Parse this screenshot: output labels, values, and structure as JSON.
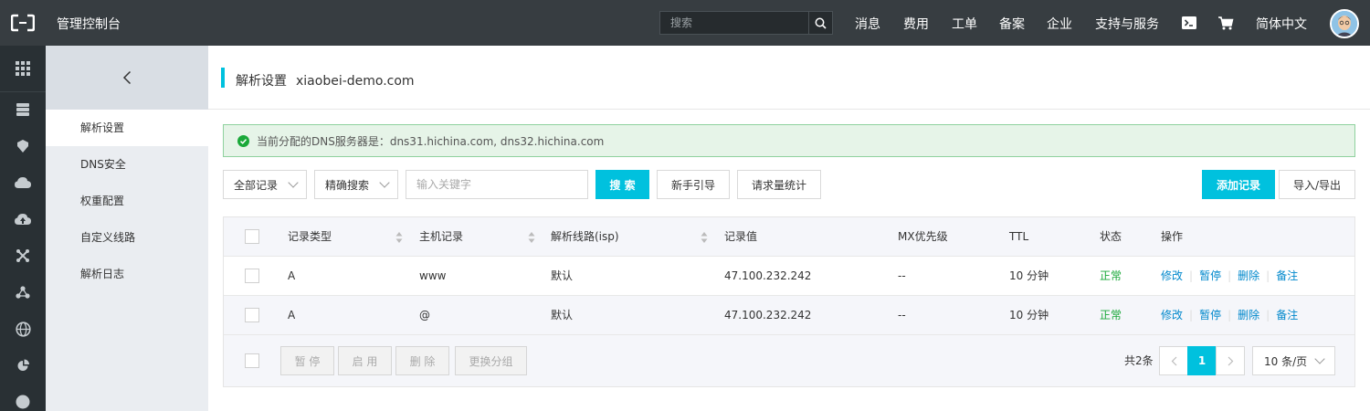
{
  "topbar": {
    "title": "管理控制台",
    "search_placeholder": "搜索",
    "nav": [
      "消息",
      "费用",
      "工单",
      "备案",
      "企业",
      "支持与服务"
    ],
    "language": "简体中文",
    "bg_color": "#373d41"
  },
  "subnav": {
    "items": [
      "解析设置",
      "DNS安全",
      "权重配置",
      "自定义线路",
      "解析日志"
    ],
    "active": "解析设置"
  },
  "page": {
    "title": "解析设置",
    "domain": "xiaobei-demo.com"
  },
  "alert": {
    "text": "当前分配的DNS服务器是：dns31.hichina.com, dns32.hichina.com"
  },
  "toolbar": {
    "record_filter": "全部记录",
    "search_mode": "精确搜索",
    "keyword_placeholder": "输入关键字",
    "search_label": "搜 索",
    "guide_label": "新手引导",
    "stats_label": "请求量统计",
    "add_label": "添加记录",
    "import_export_label": "导入/导出"
  },
  "table": {
    "columns": [
      "记录类型",
      "主机记录",
      "解析线路(isp)",
      "记录值",
      "MX优先级",
      "TTL",
      "状态",
      "操作"
    ],
    "rows": [
      {
        "type": "A",
        "host": "www",
        "line": "默认",
        "value": "47.100.232.242",
        "mx": "--",
        "ttl": "10 分钟",
        "status": "正常"
      },
      {
        "type": "A",
        "host": "@",
        "line": "默认",
        "value": "47.100.232.242",
        "mx": "--",
        "ttl": "10 分钟",
        "status": "正常"
      }
    ],
    "actions": [
      "修改",
      "暂停",
      "删除",
      "备注"
    ]
  },
  "footer": {
    "bulk_pause": "暂 停",
    "bulk_enable": "启 用",
    "bulk_delete": "删 除",
    "bulk_group": "更换分组",
    "total": "共2条",
    "current_page": "1",
    "page_size": "10 条/页"
  },
  "colors": {
    "accent": "#00c1de",
    "success": "#1aa839",
    "link": "#0088cc"
  }
}
